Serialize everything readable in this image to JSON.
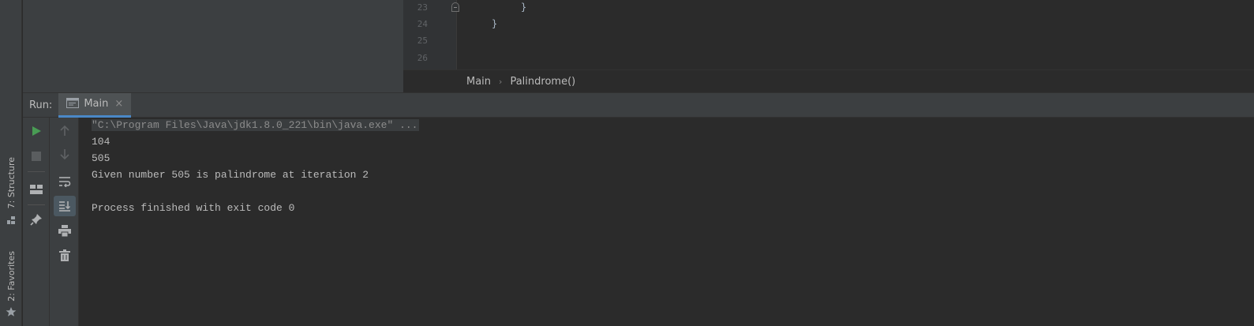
{
  "editor": {
    "line_numbers": [
      "23",
      "24",
      "25",
      "26"
    ],
    "code_lines": [
      "}",
      "}"
    ]
  },
  "breadcrumb": {
    "items": [
      "Main",
      "Palindrome()"
    ]
  },
  "run_panel": {
    "title": "Run:",
    "tab_label": "Main",
    "tab_close": "×"
  },
  "side_tabs": {
    "structure": "7: Structure",
    "favorites": "2: Favorites"
  },
  "console": {
    "lines": [
      "\"C:\\Program Files\\Java\\jdk1.8.0_221\\bin\\java.exe\" ...",
      "104",
      "505",
      "Given number 505 is palindrome at iteration 2",
      "",
      "Process finished with exit code 0"
    ]
  },
  "toolbar": {
    "icons": [
      "rerun-icon",
      "stop-icon",
      "layout-icon",
      "pin-icon",
      "up-arrow-icon",
      "down-arrow-icon",
      "soft-wrap-icon",
      "scroll-to-end-icon",
      "print-icon",
      "trash-icon"
    ]
  },
  "colors": {
    "accent": "#4a88c7",
    "run_green": "#499c54",
    "background": "#2b2b2b",
    "panel": "#3c3f41"
  }
}
